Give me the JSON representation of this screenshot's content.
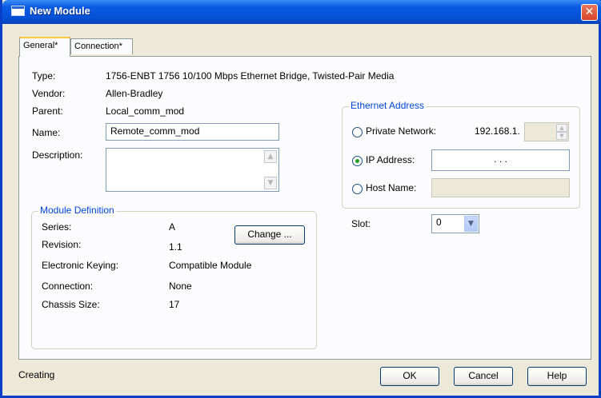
{
  "window": {
    "title": "New Module",
    "close_glyph": "✕"
  },
  "tabs": [
    {
      "label": "General*",
      "active": true
    },
    {
      "label": "Connection*",
      "active": false
    }
  ],
  "general": {
    "type_label": "Type:",
    "type_value": "1756-ENBT 1756 10/100 Mbps Ethernet Bridge, Twisted-Pair Media",
    "vendor_label": "Vendor:",
    "vendor_value": "Allen-Bradley",
    "parent_label": "Parent:",
    "parent_value": "Local_comm_mod",
    "name_label": "Name:",
    "name_value": "Remote_comm_mod",
    "description_label": "Description:",
    "description_value": ""
  },
  "module_definition": {
    "title": "Module Definition",
    "series_label": "Series:",
    "series_value": "A",
    "revision_label": "Revision:",
    "revision_value": "1.1",
    "keying_label": "Electronic Keying:",
    "keying_value": "Compatible Module",
    "connection_label": "Connection:",
    "connection_value": "None",
    "chassis_label": "Chassis Size:",
    "chassis_value": "17",
    "change_button": "Change ..."
  },
  "ethernet_address": {
    "title": "Ethernet Address",
    "options": [
      {
        "label": "Private Network:",
        "checked": false
      },
      {
        "label": "IP Address:",
        "checked": true
      },
      {
        "label": "Host Name:",
        "checked": false
      }
    ],
    "private_prefix": "192.168.1.",
    "private_last_octet": "",
    "ip_dots": ".          .          .",
    "host_name_value": ""
  },
  "slot": {
    "label": "Slot:",
    "value": "0"
  },
  "status": {
    "text": "Creating"
  },
  "buttons": {
    "ok": "OK",
    "cancel": "Cancel",
    "help": "Help"
  },
  "colors": {
    "title_bar": "#0552d8",
    "dialog_bg": "#ece9d8",
    "group_title": "#0046d5",
    "radio_dot": "#21a121",
    "active_tab_accent": "#ffc83c"
  },
  "icons": {
    "window": "window-icon",
    "close": "close-icon",
    "spin_up": "spin-up-icon",
    "spin_down": "spin-down-icon",
    "scroll_up": "scroll-up-icon",
    "scroll_down": "scroll-down-icon",
    "dropdown": "chevron-down-icon"
  }
}
